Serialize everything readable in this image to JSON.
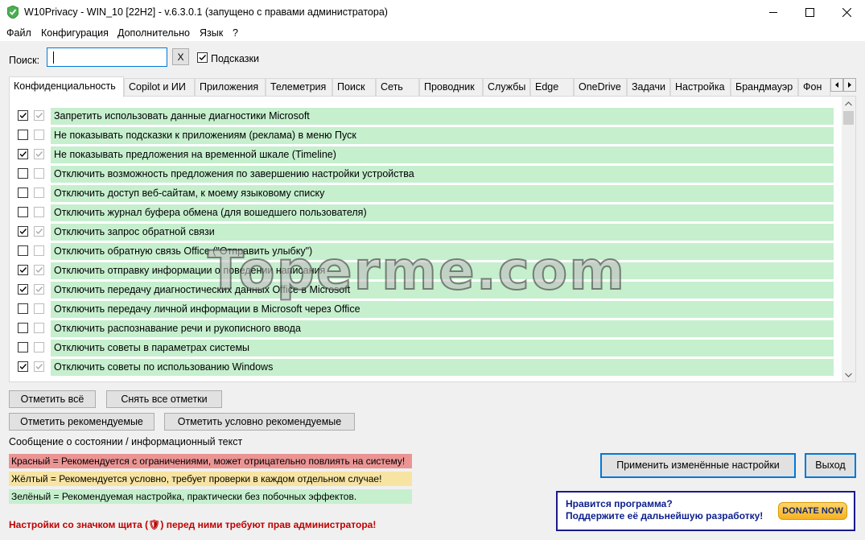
{
  "window": {
    "title": "W10Privacy - WIN_10 [22H2] - v.6.3.0.1 (запущено с правами администратора)"
  },
  "menu": [
    "Файл",
    "Конфигурация",
    "Дополнительно",
    "Язык",
    "?"
  ],
  "search": {
    "label": "Поиск:",
    "value": "",
    "clear_label": "X",
    "hints_label": "Подсказки",
    "hints_checked": true
  },
  "tabs": [
    {
      "label": "Конфиденциальность",
      "active": true
    },
    {
      "label": "Copilot и ИИ"
    },
    {
      "label": "Приложения"
    },
    {
      "label": "Телеметрия"
    },
    {
      "label": "Поиск"
    },
    {
      "label": "Сеть"
    },
    {
      "label": "Проводник"
    },
    {
      "label": "Службы"
    },
    {
      "label": "Edge"
    },
    {
      "label": "OneDrive"
    },
    {
      "label": "Задачи"
    },
    {
      "label": "Настройка"
    },
    {
      "label": "Брандмауэр"
    },
    {
      "label": "Фон"
    }
  ],
  "settings": [
    {
      "label": "Запретить использовать данные диагностики Microsoft",
      "checked": true
    },
    {
      "label": "Не показывать подсказки к приложениям (реклама) в меню Пуск",
      "checked": false
    },
    {
      "label": "Не показывать предложения на временной шкале (Timeline)",
      "checked": true
    },
    {
      "label": "Отключить возможность предложения по завершению настройки устройства",
      "checked": false
    },
    {
      "label": "Отключить доступ веб-сайтам, к моему языковому списку",
      "checked": false
    },
    {
      "label": "Отключить журнал буфера обмена (для вошедшего пользователя)",
      "checked": false
    },
    {
      "label": "Отключить запрос обратной связи",
      "checked": true
    },
    {
      "label": "Отключить обратную связь Office (\"Отправить улыбку\")",
      "checked": false
    },
    {
      "label": "Отключить отправку информации о поведении написания",
      "checked": true
    },
    {
      "label": "Отключить передачу диагностических данных Office в Microsoft",
      "checked": true
    },
    {
      "label": "Отключить передачу личной информации в Microsoft через Office",
      "checked": false
    },
    {
      "label": "Отключить распознавание речи и рукописного ввода",
      "checked": false
    },
    {
      "label": "Отключить советы в параметрах системы",
      "checked": false
    },
    {
      "label": "Отключить советы по использованию Windows",
      "checked": true
    }
  ],
  "watermark": "Toperme.com",
  "buttons": {
    "check_all": "Отметить всё",
    "uncheck_all": "Снять все отметки",
    "check_recommended": "Отметить рекомендуемые",
    "check_conditional": "Отметить условно рекомендуемые",
    "apply": "Применить изменённые настройки",
    "exit": "Выход"
  },
  "status": {
    "caption": "Сообщение о состоянии / информационный текст",
    "red": "Красный = Рекомендуется с ограничениями, может отрицательно повлиять на систему!",
    "yellow": "Жёлтый = Рекомендуется условно, требует проверки в каждом отдельном случае!",
    "green": "Зелёный = Рекомендуемая настройка, практически без побочных эффектов.",
    "admin_note": "Настройки со значком щита (🛡) перед ними требуют прав администратора!"
  },
  "donate": {
    "line1": "Нравится программа?",
    "line2": "Поддержите её дальнейшую разработку!",
    "button": "DONATE NOW"
  },
  "colors": {
    "green": "#c6efce",
    "red": "#eb9494",
    "yellow": "#f7e4a3",
    "accent": "#0078d7"
  }
}
